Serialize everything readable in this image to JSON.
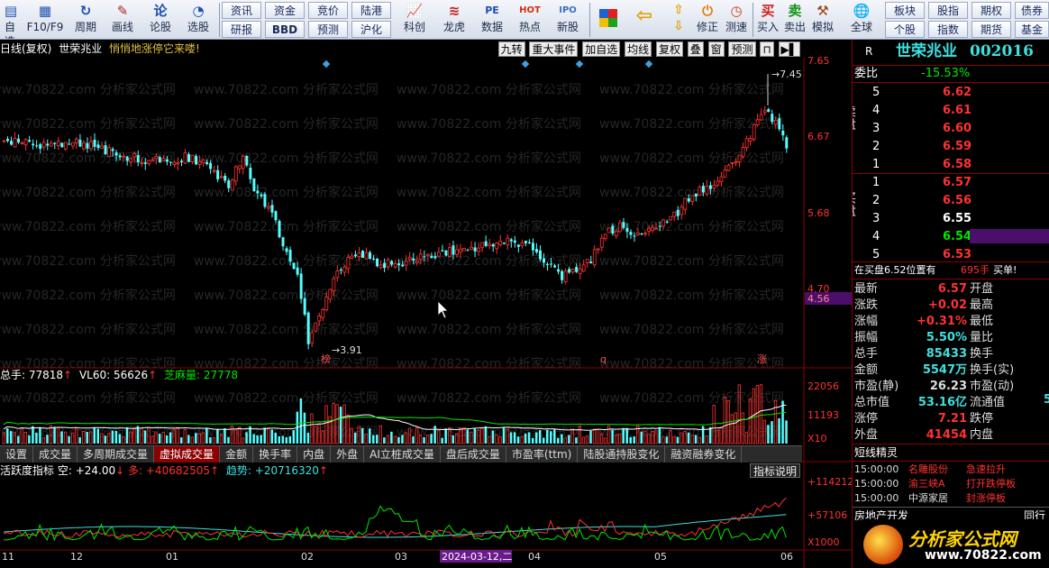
{
  "toolbar": {
    "buttons": [
      {
        "label": "自选",
        "icon": "calendar-icon"
      },
      {
        "label": "F10/F9",
        "icon": "grid-icon"
      },
      {
        "label": "周期",
        "icon": "history-icon"
      },
      {
        "label": "画线",
        "icon": "pencil-icon"
      },
      {
        "label": "论股",
        "icon": "chat-icon"
      },
      {
        "label": "选股",
        "icon": "gauge-icon"
      }
    ],
    "pairs": [
      [
        "资讯",
        "研报"
      ],
      [
        "资金",
        "BBD"
      ],
      [
        "竞价",
        "预测"
      ],
      [
        "陆港",
        "沪化"
      ]
    ],
    "icon_buttons": [
      {
        "label": "科创",
        "icon": "chart-icon"
      },
      {
        "label": "龙虎",
        "icon": "dragon-icon"
      },
      {
        "label": "数据",
        "icon": "pe-icon"
      },
      {
        "label": "热点",
        "icon": "hot-icon"
      },
      {
        "label": "新股",
        "icon": "ipo-icon"
      }
    ],
    "tools": [
      {
        "label": "",
        "icon": "quad-color-icon"
      },
      {
        "label": "",
        "icon": "back-arrow-icon"
      },
      {
        "label": "",
        "icon": "up-down-icon"
      },
      {
        "label": "修正",
        "icon": "power-icon"
      },
      {
        "label": "测速",
        "icon": "clock-icon"
      },
      {
        "label": "买入",
        "icon": "buy-icon"
      },
      {
        "label": "卖出",
        "icon": "sell-icon"
      },
      {
        "label": "模拟",
        "icon": "hammer-icon"
      },
      {
        "label": "全球",
        "icon": "globe-icon"
      }
    ],
    "right_pairs": [
      [
        "板块",
        "个股"
      ],
      [
        "股指",
        "指数"
      ],
      [
        "期权",
        "期货"
      ],
      [
        "债券",
        "基金"
      ]
    ]
  },
  "chart": {
    "period": "日线(复权)",
    "stock_name": "世荣兆业",
    "tagline": "悄悄地涨停它来喽!",
    "menu": [
      "九转",
      "重大事件",
      "加自选",
      "均线",
      "复权",
      "叠",
      "窗",
      "预测"
    ],
    "price_axis": [
      "7.65",
      "6.67",
      "5.68",
      "4.70",
      "4.56"
    ],
    "high_label": "7.45",
    "low_label": "3.91",
    "event_labels": [
      "榜",
      "q",
      "涨"
    ],
    "watermark": "www.70822.com 分析家公式网"
  },
  "volume": {
    "header_total": "总手: 77818",
    "header_vl": "VL60: 56626",
    "header_zhi": "芝麻量: 27778",
    "axis": [
      "22056",
      "11193",
      "X10"
    ]
  },
  "tabs": [
    "设置",
    "成交量",
    "多周期成交量",
    "虚拟成交量",
    "金额",
    "换手率",
    "内盘",
    "外盘",
    "AI立桩成交量",
    "盘后成交量",
    "市盈率(ttm)",
    "陆股通持股变化",
    "融资融券变化"
  ],
  "active_tab": "虚拟成交量",
  "indicator": {
    "name": "活跃度指标",
    "v1": "空: +24.00",
    "v2": "多: +40682505",
    "v3": "趋势: +20716320",
    "button": "指标说明",
    "axis": [
      "+114212",
      "+57106",
      "X1000"
    ]
  },
  "dates": [
    "11",
    "12",
    "01",
    "02",
    "03",
    "2024-03-12,二",
    "04",
    "05",
    "06"
  ],
  "quote": {
    "flag": "R",
    "name": "世荣兆业",
    "code": "002016",
    "weibi_label": "委比",
    "weibi": "-15.53%",
    "sell_side": "卖盘",
    "buy_side": "买盘",
    "sells": [
      {
        "n": "5",
        "p": "6.62"
      },
      {
        "n": "4",
        "p": "6.61"
      },
      {
        "n": "3",
        "p": "6.60"
      },
      {
        "n": "2",
        "p": "6.59"
      },
      {
        "n": "1",
        "p": "6.58"
      }
    ],
    "buys": [
      {
        "n": "1",
        "p": "6.57"
      },
      {
        "n": "2",
        "p": "6.56"
      },
      {
        "n": "3",
        "p": "6.55"
      },
      {
        "n": "4",
        "p": "6.54"
      },
      {
        "n": "5",
        "p": "6.53"
      }
    ],
    "status": "在买盘6.52位置有",
    "status_qty": "695手",
    "status_tail": "买单!",
    "stats": [
      {
        "l": "最新",
        "v": "6.57",
        "r": "开盘"
      },
      {
        "l": "涨跌",
        "v": "+0.02",
        "r": "最高"
      },
      {
        "l": "涨幅",
        "v": "+0.31%",
        "r": "最低"
      },
      {
        "l": "振幅",
        "v": "5.50%",
        "r": "量比"
      },
      {
        "l": "总手",
        "v": "85433",
        "r": "换手"
      },
      {
        "l": "金额",
        "v": "5547万",
        "r": "换手(实)"
      },
      {
        "l": "市盈(静)",
        "v": "26.23",
        "r": "市盈(动)"
      },
      {
        "l": "总市值",
        "v": "53.16亿",
        "r": "流通值"
      },
      {
        "l": "涨停",
        "v": "7.21",
        "r": "跌停"
      },
      {
        "l": "外盘",
        "v": "41454",
        "r": "内盘"
      }
    ],
    "side_val": "5",
    "spirit_title": "短线精灵",
    "spirits": [
      {
        "t": "15:00:00",
        "s": "名雕股份",
        "e": "急速拉升"
      },
      {
        "t": "15:00:00",
        "s": "渝三峡A",
        "e": "打开跌停板"
      },
      {
        "t": "15:00:00",
        "s": "中源家居",
        "e": "封涨停板"
      }
    ],
    "sector": "房地产开发",
    "sector_tail": "同行",
    "logo": "分析家公式网",
    "logo_url": "www.70822.com"
  },
  "colors": {
    "up": "#ff3232",
    "down": "#54ffff",
    "accent": "#8b0000"
  }
}
